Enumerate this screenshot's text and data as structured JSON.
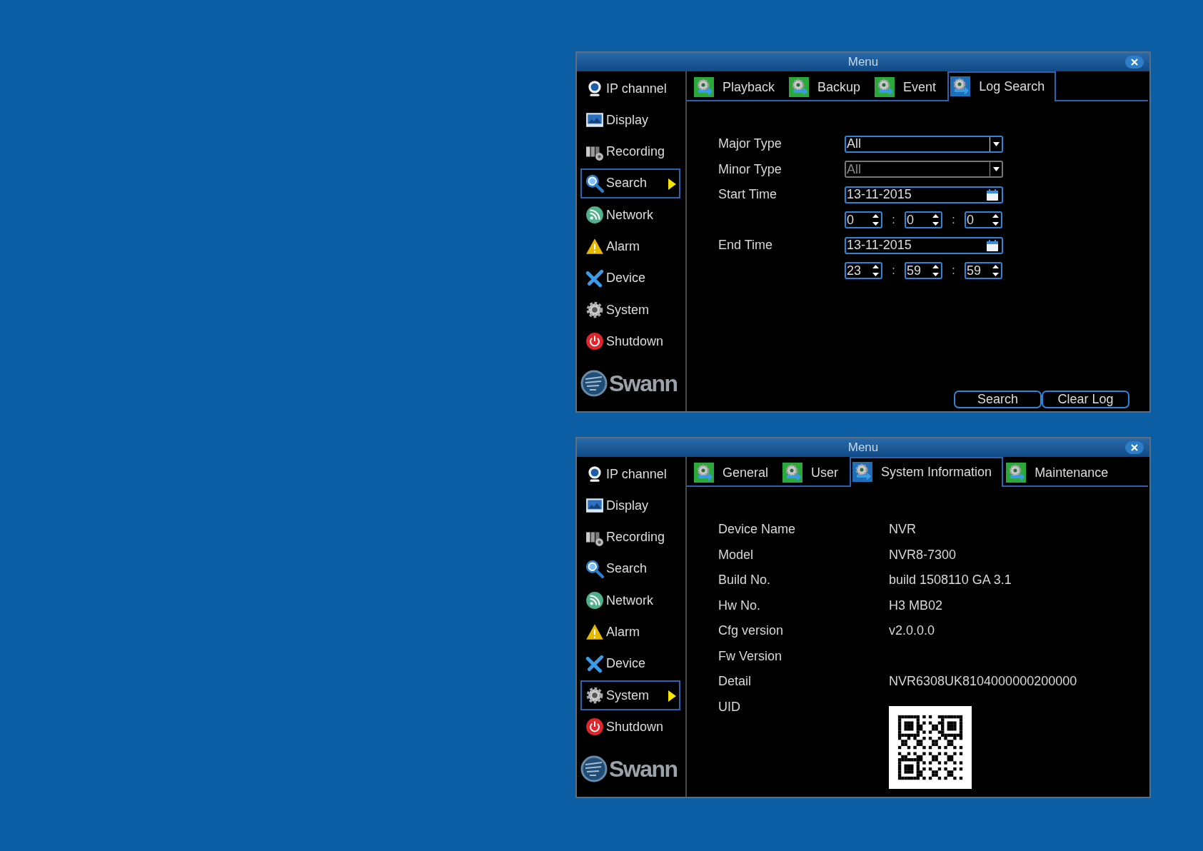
{
  "windows": [
    {
      "title": "Menu",
      "logo": "Swann",
      "sidebar": [
        {
          "kind": "ip_channel",
          "label": "IP channel",
          "selected": false
        },
        {
          "kind": "display",
          "label": "Display",
          "selected": false
        },
        {
          "kind": "recording",
          "label": "Recording",
          "selected": false
        },
        {
          "kind": "search",
          "label": "Search",
          "selected": true
        },
        {
          "kind": "network",
          "label": "Network",
          "selected": false
        },
        {
          "kind": "alarm",
          "label": "Alarm",
          "selected": false
        },
        {
          "kind": "device",
          "label": "Device",
          "selected": false
        },
        {
          "kind": "system",
          "label": "System",
          "selected": false
        },
        {
          "kind": "shutdown",
          "label": "Shutdown",
          "selected": false
        }
      ],
      "tabs": [
        {
          "label": "Playback",
          "selected": false
        },
        {
          "label": "Backup",
          "selected": false
        },
        {
          "label": "Event",
          "selected": false
        },
        {
          "label": "Log Search",
          "selected": true
        }
      ],
      "panel": {
        "kind": "form",
        "rows": [
          {
            "kind": "dropdown",
            "label": "Major Type",
            "value": "All",
            "disabled": false
          },
          {
            "kind": "dropdown",
            "label": "Minor Type",
            "value": "All",
            "disabled": true
          },
          {
            "kind": "date",
            "label": "Start Time",
            "value": "13-11-2015"
          },
          {
            "kind": "time",
            "values": [
              "0",
              "0",
              "0"
            ],
            "separator": ":"
          },
          {
            "kind": "date",
            "label": "End Time",
            "value": "13-11-2015"
          },
          {
            "kind": "time",
            "values": [
              "23",
              "59",
              "59"
            ],
            "separator": ":"
          }
        ],
        "buttons": [
          "Search",
          "Clear Log"
        ]
      }
    },
    {
      "title": "Menu",
      "logo": "Swann",
      "sidebar": [
        {
          "kind": "ip_channel",
          "label": "IP channel",
          "selected": false
        },
        {
          "kind": "display",
          "label": "Display",
          "selected": false
        },
        {
          "kind": "recording",
          "label": "Recording",
          "selected": false
        },
        {
          "kind": "search",
          "label": "Search",
          "selected": false
        },
        {
          "kind": "network",
          "label": "Network",
          "selected": false
        },
        {
          "kind": "alarm",
          "label": "Alarm",
          "selected": false
        },
        {
          "kind": "device",
          "label": "Device",
          "selected": false
        },
        {
          "kind": "system",
          "label": "System",
          "selected": true
        },
        {
          "kind": "shutdown",
          "label": "Shutdown",
          "selected": false
        }
      ],
      "tabs": [
        {
          "label": "General",
          "selected": false
        },
        {
          "label": "User",
          "selected": false
        },
        {
          "label": "System Information",
          "selected": true
        },
        {
          "label": "Maintenance",
          "selected": false
        }
      ],
      "panel": {
        "kind": "info",
        "rows": [
          {
            "kind": "text",
            "label": "Device Name",
            "value": "NVR"
          },
          {
            "kind": "text",
            "label": "Model",
            "value": "NVR8-7300"
          },
          {
            "kind": "text",
            "label": "Build No.",
            "value": "build 1508110 GA 3.1"
          },
          {
            "kind": "text",
            "label": "Hw No.",
            "value": "H3 MB02"
          },
          {
            "kind": "text",
            "label": "Cfg version",
            "value": "v2.0.0.0"
          },
          {
            "kind": "text",
            "label": "Fw Version"
          },
          {
            "kind": "text",
            "label": "Detail",
            "value": "NVR6308UK8104000000200000"
          },
          {
            "kind": "qr",
            "label": "UID"
          }
        ]
      }
    }
  ]
}
